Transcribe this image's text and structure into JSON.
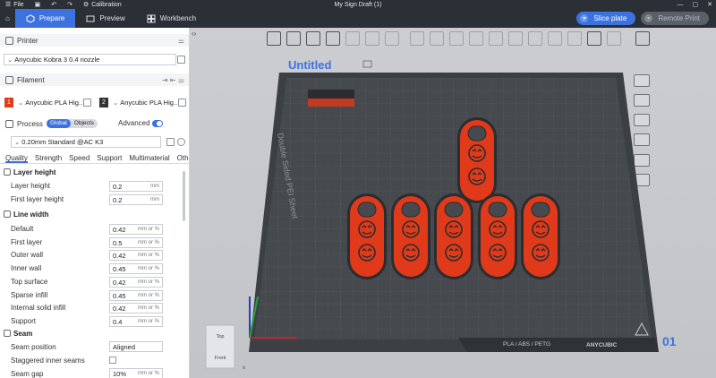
{
  "topbar": {
    "file_label": "File",
    "calibration_label": "Calibration",
    "window_title": "My Sign Draft (1)"
  },
  "tabs": [
    {
      "label": "Prepare"
    },
    {
      "label": "Preview"
    },
    {
      "label": "Workbench"
    }
  ],
  "actions": {
    "slice_label": "Slice plate",
    "remote_label": "Remote Print"
  },
  "printer": {
    "heading": "Printer",
    "selected": "Anycubic Kobra 3 0.4 nozzle"
  },
  "filament": {
    "heading": "Filament",
    "slots": [
      {
        "num": "1",
        "name": "Anycubic PLA Hig...",
        "color": "#e03a1a"
      },
      {
        "num": "2",
        "name": "Anycubic PLA Hig...",
        "color": "#333333"
      }
    ]
  },
  "process": {
    "heading": "Process",
    "global_label": "Global",
    "objects_label": "Objects",
    "advanced_label": "Advanced",
    "advanced_on": true,
    "preset": "0.20mm Standard @AC K3"
  },
  "process_tabs": [
    "Quality",
    "Strength",
    "Speed",
    "Support",
    "Multimaterial",
    "Oth..."
  ],
  "settings": {
    "layer_height_group": "Layer height",
    "layer_height": {
      "label": "Layer height",
      "value": "0.2",
      "unit": "mm"
    },
    "first_layer_height": {
      "label": "First layer height",
      "value": "0.2",
      "unit": "mm"
    },
    "line_width_group": "Line width",
    "line_widths": [
      {
        "label": "Default",
        "value": "0.42",
        "unit": "mm or %"
      },
      {
        "label": "First layer",
        "value": "0.5",
        "unit": "mm or %"
      },
      {
        "label": "Outer wall",
        "value": "0.42",
        "unit": "mm or %"
      },
      {
        "label": "Inner wall",
        "value": "0.45",
        "unit": "mm or %"
      },
      {
        "label": "Top surface",
        "value": "0.42",
        "unit": "mm or %"
      },
      {
        "label": "Sparse infill",
        "value": "0.45",
        "unit": "mm or %"
      },
      {
        "label": "Internal solid infill",
        "value": "0.42",
        "unit": "mm or %"
      },
      {
        "label": "Support",
        "value": "0.4",
        "unit": "mm or %"
      }
    ],
    "seam_group": "Seam",
    "seam_position": {
      "label": "Seam position",
      "value": "Aligned"
    },
    "staggered_label": "Staggered inner seams",
    "seam_gap": {
      "label": "Seam gap",
      "value": "10%",
      "unit": "mm or %"
    }
  },
  "viewport": {
    "plate_name": "Untitled",
    "sheet_label": "Double Sided PEI Sheet",
    "material_label": "PLA / ABS / PETG",
    "brand_label": "ANYCUBIC",
    "plate_number": "01",
    "view_top": "Top",
    "view_front": "Front",
    "axis_x": "x",
    "accent_color": "#3c72e0",
    "part_color": "#e03a1a"
  }
}
